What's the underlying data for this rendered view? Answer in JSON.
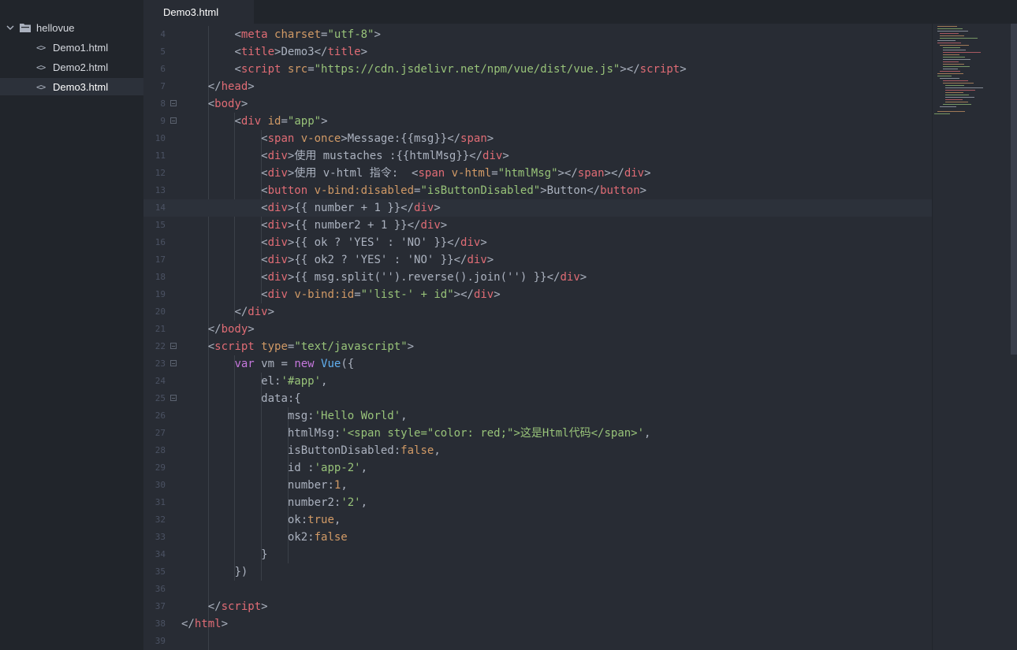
{
  "sidebar": {
    "root": "hellovue",
    "items": [
      {
        "label": "Demo1.html"
      },
      {
        "label": "Demo2.html"
      },
      {
        "label": "Demo3.html"
      }
    ]
  },
  "tab": {
    "label": "Demo3.html"
  },
  "editor": {
    "current_line": 14,
    "lines": [
      {
        "n": "4"
      },
      {
        "n": "5"
      },
      {
        "n": "6"
      },
      {
        "n": "7"
      },
      {
        "n": "8"
      },
      {
        "n": "9"
      },
      {
        "n": "10"
      },
      {
        "n": "11"
      },
      {
        "n": "12"
      },
      {
        "n": "13"
      },
      {
        "n": "14"
      },
      {
        "n": "15"
      },
      {
        "n": "16"
      },
      {
        "n": "17"
      },
      {
        "n": "18"
      },
      {
        "n": "19"
      },
      {
        "n": "20"
      },
      {
        "n": "21"
      },
      {
        "n": "22"
      },
      {
        "n": "23"
      },
      {
        "n": "24"
      },
      {
        "n": "25"
      },
      {
        "n": "26"
      },
      {
        "n": "27"
      },
      {
        "n": "28"
      },
      {
        "n": "29"
      },
      {
        "n": "30"
      },
      {
        "n": "31"
      },
      {
        "n": "32"
      },
      {
        "n": "33"
      },
      {
        "n": "34"
      },
      {
        "n": "35"
      },
      {
        "n": "36"
      },
      {
        "n": "37"
      },
      {
        "n": "38"
      },
      {
        "n": "39"
      }
    ],
    "code": {
      "l4": [
        "<",
        "meta",
        " ",
        "charset",
        "=",
        "\"utf-8\"",
        ">"
      ],
      "l5": [
        "<",
        "title",
        ">Demo3</",
        "title",
        ">"
      ],
      "l6": [
        "<",
        "script",
        " ",
        "src",
        "=",
        "\"https://cdn.jsdelivr.net/npm/vue/dist/vue.js\"",
        "></",
        "script",
        ">"
      ],
      "l7": [
        "</",
        "head",
        ">"
      ],
      "l8": [
        "<",
        "body",
        ">"
      ],
      "l9": [
        "<",
        "div",
        " ",
        "id",
        "=",
        "\"app\"",
        ">"
      ],
      "l10": [
        "<",
        "span",
        " ",
        "v-once",
        ">Message:{{msg}}</",
        "span",
        ">"
      ],
      "l11": [
        "<",
        "div",
        ">使用 mustaches :{{htmlMsg}}</",
        "div",
        ">"
      ],
      "l12": [
        "<",
        "div",
        ">使用 v-html 指令:  <",
        "span",
        " ",
        "v-html",
        "=",
        "\"htmlMsg\"",
        "></",
        "span",
        "></",
        "div",
        ">"
      ],
      "l13": [
        "<",
        "button",
        " ",
        "v-bind:disabled",
        "=",
        "\"isButtonDisabled\"",
        ">Button</",
        "button",
        ">"
      ],
      "l14": [
        "<",
        "div",
        ">{{ number + 1 }}</",
        "div",
        ">"
      ],
      "l15": [
        "<",
        "div",
        ">{{ number2 + 1 }}</",
        "div",
        ">"
      ],
      "l16": [
        "<",
        "div",
        ">{{ ok ? 'YES' : 'NO' }}</",
        "div",
        ">"
      ],
      "l17": [
        "<",
        "div",
        ">{{ ok2 ? 'YES' : 'NO' }}</",
        "div",
        ">"
      ],
      "l18": [
        "<",
        "div",
        ">{{ msg.split('').reverse().join('') }}</",
        "div",
        ">"
      ],
      "l19": [
        "<",
        "div",
        " ",
        "v-bind:id",
        "=",
        "\"'list-' + id\"",
        "></",
        "div",
        ">"
      ],
      "l20": [
        "</",
        "div",
        ">"
      ],
      "l21": [
        "</",
        "body",
        ">"
      ],
      "l22": [
        "<",
        "script",
        " ",
        "type",
        "=",
        "\"text/javascript\"",
        ">"
      ],
      "l23": [
        "var",
        " vm = ",
        "new",
        " ",
        "Vue",
        "({"
      ],
      "l24": [
        "el:",
        "'#app'",
        ","
      ],
      "l25": [
        "data:{"
      ],
      "l26": [
        "msg:",
        "'Hello World'",
        ","
      ],
      "l27": [
        "htmlMsg:",
        "'<span style=\"color: red;\">这是Html代码</span>'",
        ","
      ],
      "l28": [
        "isButtonDisabled:",
        "false",
        ","
      ],
      "l29": [
        "id :",
        "'app-2'",
        ","
      ],
      "l30": [
        "number:",
        "1",
        ","
      ],
      "l31": [
        "number2:",
        "'2'",
        ","
      ],
      "l32": [
        "ok:",
        "true",
        ","
      ],
      "l33": [
        "ok2:",
        "false"
      ],
      "l34": [
        "}"
      ],
      "l35": [
        "})"
      ],
      "l37": [
        "</",
        "script",
        ">"
      ],
      "l38": [
        "</",
        "html",
        ">"
      ]
    }
  },
  "colors": {
    "background": "#282c34",
    "sidebar": "#21252b",
    "tag": "#e06c75",
    "attribute": "#d19a66",
    "string": "#98c379",
    "keyword": "#c678dd",
    "function": "#61afef"
  },
  "icons": [
    "chevron-down-icon",
    "folder-icon",
    "file-code-icon"
  ]
}
